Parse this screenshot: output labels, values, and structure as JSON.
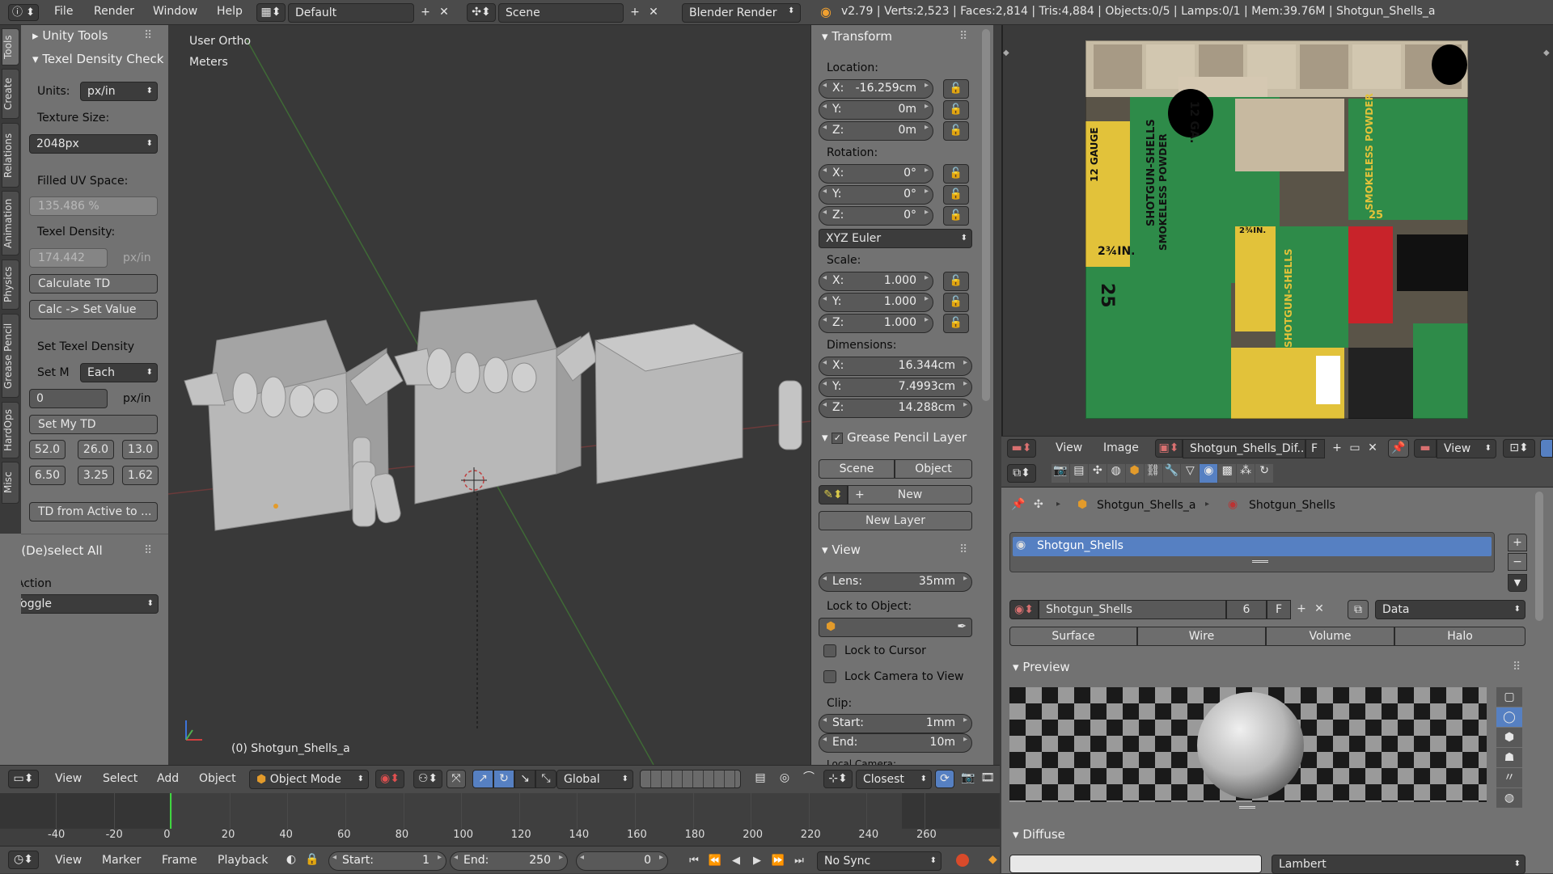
{
  "topbar": {
    "menus": [
      "File",
      "Render",
      "Window",
      "Help"
    ],
    "layout_name": "Default",
    "scene_name": "Scene",
    "render_engine": "Blender Render",
    "stats": "v2.79 | Verts:2,523 | Faces:2,814 | Tris:4,884 | Objects:0/5 | Lamps:0/1 | Mem:39.76M | Shotgun_Shells_a"
  },
  "left_tabs": [
    "Tools",
    "Create",
    "Relations",
    "Animation",
    "Physics",
    "Grease Pencil",
    "HardOps",
    "Misc"
  ],
  "tool_panel": {
    "unity_tools": "Unity Tools",
    "texel_header": "Texel Density Check",
    "units_label": "Units:",
    "units_value": "px/in",
    "texture_size_label": "Texture Size:",
    "texture_size_value": "2048px",
    "filled_uv_label": "Filled UV Space:",
    "filled_uv_value": "135.486 %",
    "texel_density_label": "Texel Density:",
    "texel_density_value": "174.442",
    "texel_density_unit": "px/in",
    "calc_td": "Calculate TD",
    "calc_set": "Calc -> Set Value",
    "set_texel_label": "Set Texel Density",
    "set_m_label": "Set M",
    "set_m_value": "Each",
    "set_value": "0",
    "set_value_unit": "px/in",
    "set_my_td": "Set My TD",
    "presets": [
      "52.0",
      "26.0",
      "13.0",
      "6.50",
      "3.25",
      "1.62"
    ],
    "td_from_active": "TD from Active to ...",
    "deselect_header": "(De)select All",
    "action_label": "Action",
    "action_value": "Toggle"
  },
  "viewport": {
    "view_name": "User Ortho",
    "units": "Meters",
    "object_label": "(0) Shotgun_Shells_a"
  },
  "properties": {
    "transform_header": "Transform",
    "location_label": "Location:",
    "location": [
      {
        "k": "X:",
        "v": "-16.259cm"
      },
      {
        "k": "Y:",
        "v": "0m"
      },
      {
        "k": "Z:",
        "v": "0m"
      }
    ],
    "rotation_label": "Rotation:",
    "rotation": [
      {
        "k": "X:",
        "v": "0°"
      },
      {
        "k": "Y:",
        "v": "0°"
      },
      {
        "k": "Z:",
        "v": "0°"
      }
    ],
    "rotation_mode": "XYZ Euler",
    "scale_label": "Scale:",
    "scale": [
      {
        "k": "X:",
        "v": "1.000"
      },
      {
        "k": "Y:",
        "v": "1.000"
      },
      {
        "k": "Z:",
        "v": "1.000"
      }
    ],
    "dimensions_label": "Dimensions:",
    "dimensions": [
      {
        "k": "X:",
        "v": "16.344cm"
      },
      {
        "k": "Y:",
        "v": "7.4993cm"
      },
      {
        "k": "Z:",
        "v": "14.288cm"
      }
    ],
    "grease_header": "Grease Pencil Layer",
    "scene_tab": "Scene",
    "object_tab": "Object",
    "new_label": "New",
    "new_layer": "New Layer",
    "view_header": "View",
    "lens_label": "Lens:",
    "lens_value": "35mm",
    "lock_object_label": "Lock to Object:",
    "lock_cursor": "Lock to Cursor",
    "lock_camera": "Lock Camera to View",
    "clip_label": "Clip:",
    "clip_start_label": "Start:",
    "clip_start_value": "1mm",
    "clip_end_label": "End:",
    "clip_end_value": "10m",
    "local_camera": "Local Camera:"
  },
  "view3d_header": {
    "menus": [
      "View",
      "Select",
      "Add",
      "Object"
    ],
    "mode": "Object Mode",
    "orientation": "Global",
    "snap": "Closest"
  },
  "timeline": {
    "ticks": [
      "-40",
      "-20",
      "0",
      "20",
      "40",
      "60",
      "80",
      "100",
      "120",
      "140",
      "160",
      "180",
      "200",
      "220",
      "240",
      "260"
    ],
    "menus": [
      "View",
      "Marker",
      "Frame",
      "Playback"
    ],
    "start_label": "Start:",
    "start_value": "1",
    "end_label": "End:",
    "end_value": "250",
    "current_frame": "0",
    "sync": "No Sync"
  },
  "image_editor": {
    "menus": [
      "View",
      "Image"
    ],
    "image_name": "Shotgun_Shells_Dif...",
    "f_label": "F",
    "view_menu": "View",
    "texture_texts": [
      "SHOTGUN-SHELLS",
      "SMOKELESS POWDER",
      "12 GAUGE",
      "12 GA.",
      "2¾IN.",
      "25",
      "SHOTGUN-SHELLS",
      "SMOKELESS POWDER",
      "25",
      "2¾IN."
    ]
  },
  "material": {
    "breadcrumb_object": "Shotgun_Shells_a",
    "breadcrumb_material": "Shotgun_Shells",
    "slot_name": "Shotgun_Shells",
    "material_name": "Shotgun_Shells",
    "users": "6",
    "f_label": "F",
    "link": "Data",
    "tabs": [
      "Surface",
      "Wire",
      "Volume",
      "Halo"
    ],
    "preview_header": "Preview",
    "diffuse_header": "Diffuse",
    "diffuse_shader": "Lambert"
  },
  "colors": {
    "accent": "#5680c2",
    "header": "#4b4b4b",
    "viewport": "#393939",
    "panel": "#727272"
  }
}
